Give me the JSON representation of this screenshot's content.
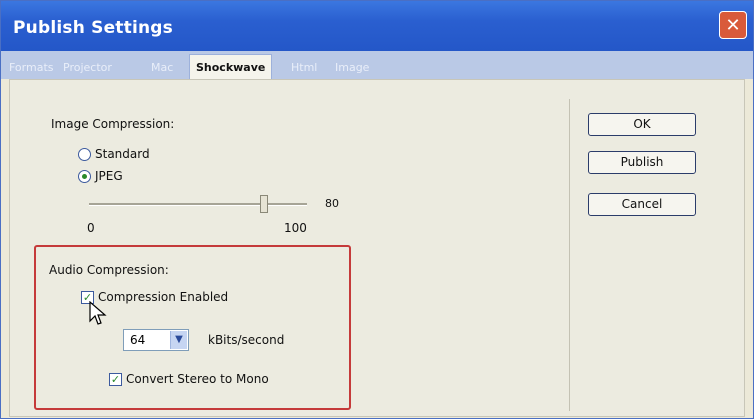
{
  "window": {
    "title": "Publish Settings"
  },
  "tabs": [
    {
      "label": "Formats"
    },
    {
      "label": "Projector"
    },
    {
      "label": "Mac"
    },
    {
      "label": "Shockwave"
    },
    {
      "label": "Html"
    },
    {
      "label": "Image"
    }
  ],
  "image_compression": {
    "label": "Image Compression:",
    "options": [
      {
        "label": "Standard",
        "selected": false
      },
      {
        "label": "JPEG",
        "selected": true
      }
    ],
    "quality_value": "80",
    "slider_fraction": 0.8,
    "min_label": "0",
    "max_label": "100"
  },
  "audio_compression": {
    "label": "Audio Compression:",
    "compression_enabled_label": "Compression Enabled",
    "compression_enabled": true,
    "rate_value": "64",
    "rate_unit": "kBits/second",
    "stereo_to_mono_label": "Convert Stereo to Mono",
    "stereo_to_mono": true
  },
  "buttons": {
    "ok": "OK",
    "publish": "Publish",
    "cancel": "Cancel"
  },
  "colors": {
    "title_bar": "#2a5fd0",
    "highlight_box": "#c53a3a"
  }
}
